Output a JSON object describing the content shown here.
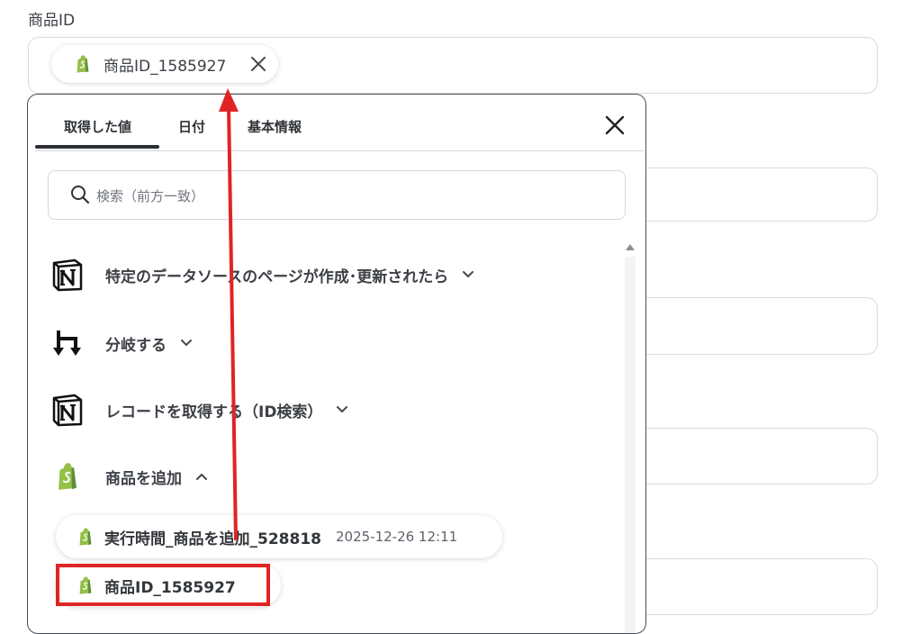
{
  "field": {
    "label": "商品ID"
  },
  "selected_chip": {
    "text": "商品ID_1585927",
    "icon": "shopify-icon"
  },
  "popup": {
    "tabs": [
      {
        "label": "取得した値",
        "active": true
      },
      {
        "label": "日付",
        "active": false
      },
      {
        "label": "基本情報",
        "active": false
      }
    ],
    "search_placeholder": "検索（前方一致）",
    "groups": [
      {
        "label": "特定のデータソースのページが作成･更新されたら",
        "icon": "notion-icon",
        "expanded": false
      },
      {
        "label": "分岐する",
        "icon": "branch-icon",
        "expanded": false
      },
      {
        "label": "レコードを取得する（ID検索）",
        "icon": "notion-icon",
        "expanded": false
      },
      {
        "label": "商品を追加",
        "icon": "shopify-icon",
        "expanded": true
      }
    ],
    "items": [
      {
        "label": "実行時間_商品を追加_528818",
        "value": "2025-12-26 12:11",
        "icon": "shopify-icon"
      },
      {
        "label": "商品ID_1585927",
        "icon": "shopify-icon",
        "highlighted": true
      }
    ]
  },
  "colors": {
    "highlight": "#e02424",
    "shopify": "#95bf47",
    "arrow": "#e02424"
  }
}
